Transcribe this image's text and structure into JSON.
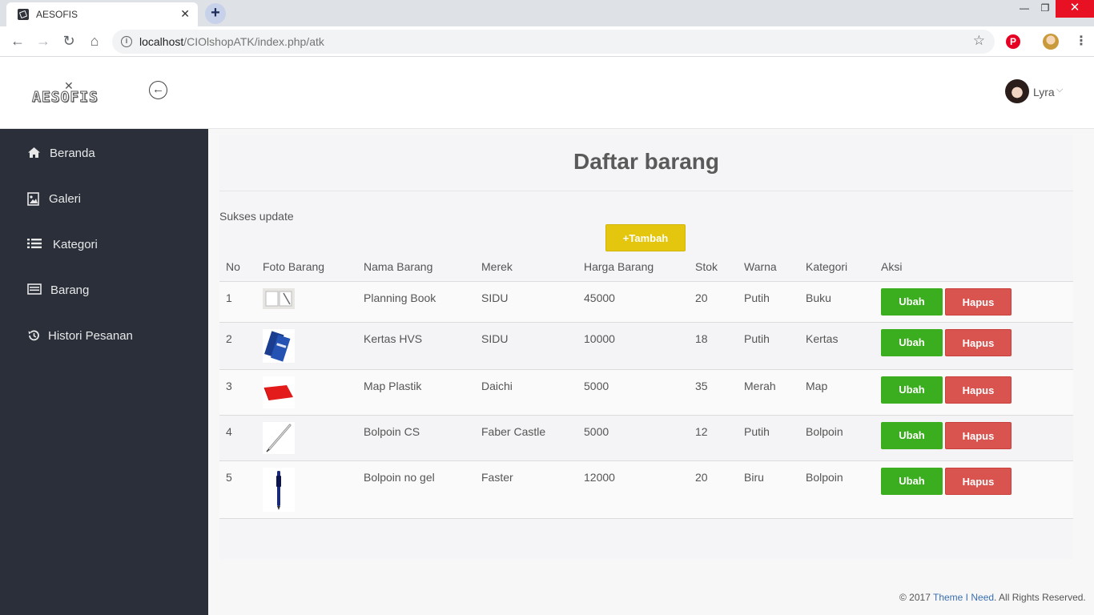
{
  "browser": {
    "tab_title": "AESOFIS",
    "tab_close": "✕",
    "newtab": "+",
    "url_host": "localhost",
    "url_path": "/CIOlshopATK/index.php/atk",
    "win_min": "—",
    "win_max": "❐",
    "win_close": "✕"
  },
  "header": {
    "logo_text": "AESOFIS",
    "user_name": "Lyra"
  },
  "sidebar": {
    "items": [
      {
        "label": "Beranda",
        "icon": "home-icon"
      },
      {
        "label": "Galeri",
        "icon": "image-icon"
      },
      {
        "label": "Kategori",
        "icon": "list-icon"
      },
      {
        "label": "Barang",
        "icon": "card-icon"
      },
      {
        "label": "Histori Pesanan",
        "icon": "history-icon"
      }
    ]
  },
  "main": {
    "title": "Daftar barang",
    "flash": "Sukses update",
    "add_label": "+Tambah",
    "columns": [
      "No",
      "Foto Barang",
      "Nama Barang",
      "Merek",
      "Harga Barang",
      "Stok",
      "Warna",
      "Kategori",
      "Aksi"
    ],
    "rows": [
      {
        "no": "1",
        "nama": "Planning Book",
        "merek": "SIDU",
        "harga": "45000",
        "stok": "20",
        "warna": "Putih",
        "kategori": "Buku"
      },
      {
        "no": "2",
        "nama": "Kertas HVS",
        "merek": "SIDU",
        "harga": "10000",
        "stok": "18",
        "warna": "Putih",
        "kategori": "Kertas"
      },
      {
        "no": "3",
        "nama": "Map Plastik",
        "merek": "Daichi",
        "harga": "5000",
        "stok": "35",
        "warna": "Merah",
        "kategori": "Map"
      },
      {
        "no": "4",
        "nama": "Bolpoin CS",
        "merek": "Faber Castle",
        "harga": "5000",
        "stok": "12",
        "warna": "Putih",
        "kategori": "Bolpoin"
      },
      {
        "no": "5",
        "nama": "Bolpoin no gel",
        "merek": "Faster",
        "harga": "12000",
        "stok": "20",
        "warna": "Biru",
        "kategori": "Bolpoin"
      }
    ],
    "edit_label": "Ubah",
    "delete_label": "Hapus"
  },
  "footer": {
    "prefix": "© 2017 ",
    "link": "Theme I Need",
    "suffix": ". All Rights Reserved."
  },
  "colors": {
    "sidebar": "#2a2f3a",
    "add_button": "#e3c60d",
    "edit_button": "#3aae1e",
    "delete_button": "#d9534f"
  }
}
